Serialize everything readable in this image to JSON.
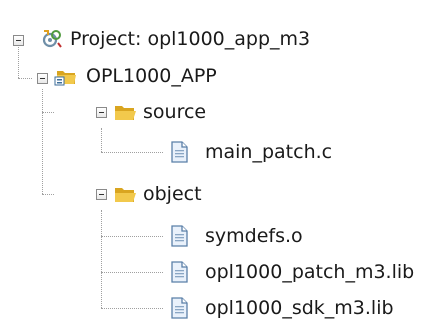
{
  "tree": {
    "project": {
      "label": "Project: opl1000_app_m3",
      "icon": "project-icon",
      "expanded": true
    },
    "target": {
      "label": "OPL1000_APP",
      "icon": "target-folder-icon",
      "expanded": true
    },
    "groups": [
      {
        "label": "source",
        "icon": "folder-icon",
        "expanded": true,
        "files": [
          {
            "label": "main_patch.c",
            "icon": "file-icon"
          }
        ]
      },
      {
        "label": "object",
        "icon": "folder-icon",
        "expanded": true,
        "files": [
          {
            "label": "symdefs.o",
            "icon": "file-icon"
          },
          {
            "label": "opl1000_patch_m3.lib",
            "icon": "file-icon"
          },
          {
            "label": "opl1000_sdk_m3.lib",
            "icon": "file-icon"
          }
        ]
      }
    ]
  },
  "colors": {
    "folder": "#f2c94c",
    "folder_dark": "#d9a520",
    "file_border": "#5a7fa8",
    "file_fill": "#e9f1fb",
    "tree_lines": "#a0a0a0"
  }
}
